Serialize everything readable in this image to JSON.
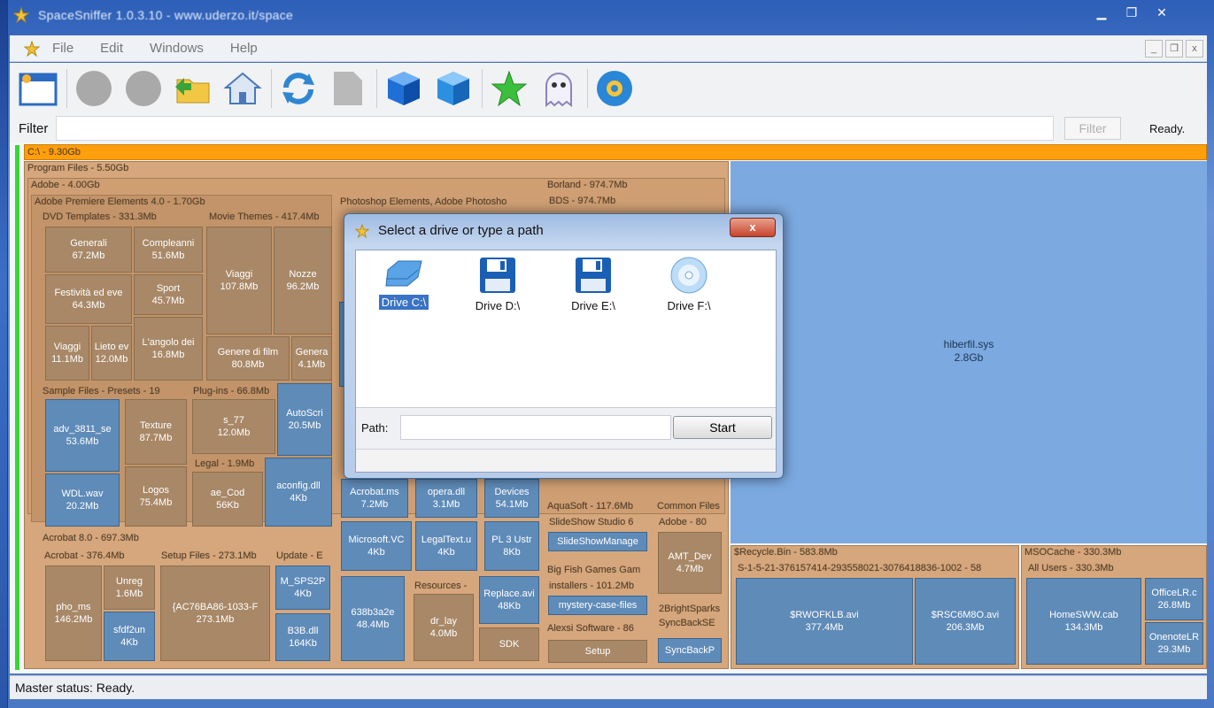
{
  "window": {
    "title": "SpaceSniffer 1.0.3.10 - www.uderzo.it/space"
  },
  "menu": [
    "File",
    "Edit",
    "Windows",
    "Help"
  ],
  "filter": {
    "label": "Filter",
    "value": "",
    "button": "Filter",
    "status": "Ready."
  },
  "treemap": {
    "root": "C:\\ - 9.30Gb",
    "labels": {
      "program_files": "Program Files - 5.50Gb",
      "adobe": "Adobe - 4.00Gb",
      "premiere": "Adobe Premiere Elements 4.0 - 1.70Gb",
      "photoshop": "Photoshop Elements, Adobe Photosho",
      "borland": "Borland - 974.7Mb",
      "bds": "BDS - 974.7Mb",
      "dvd": "DVD Templates - 331.3Mb",
      "movie": "Movie Themes - 417.4Mb",
      "sample": "Sample Files - Presets - 19",
      "plugins": "Plug-ins - 66.8Mb",
      "legal": "Legal - 1.9Mb",
      "acrobat": "Acrobat 8.0 - 697.3Mb",
      "acrobat2": "Acrobat - 376.4Mb",
      "setup_files": "Setup Files - 273.1Mb",
      "update": "Update - E",
      "resources": "Resources -",
      "aquasoft": "AquaSoft - 117.6Mb",
      "slideshow": "SlideShow Studio 6",
      "common": "Common Files",
      "adobe80": "Adobe - 80",
      "bigfish": "Big Fish Games Gam",
      "installers": "installers - 101.2Mb",
      "alexis": "Alexsi Software - 86",
      "brightspark": "2BrightSparks",
      "syncback": "SyncBackSE",
      "recycle": "$Recycle.Bin - 583.8Mb",
      "sid": "S-1-5-21-376157414-293558021-3076418836-1002 - 58",
      "msocache": "MSOCache - 330.3Mb",
      "allusers": "All Users - 330.3Mb"
    },
    "cells": {
      "generali": [
        "Generali",
        "67.2Mb"
      ],
      "compleanni": [
        "Compleanni",
        "51.6Mb"
      ],
      "viaggi": [
        "Viaggi",
        "107.8Mb"
      ],
      "nozze": [
        "Nozze",
        "96.2Mb"
      ],
      "festivita": [
        "Festività ed eve",
        "64.3Mb"
      ],
      "sport": [
        "Sport",
        "45.7Mb"
      ],
      "viaggi2": [
        "Viaggi",
        "11.1Mb"
      ],
      "lieto": [
        "Lieto ev",
        "12.0Mb"
      ],
      "angolo": [
        "L'angolo dei",
        "16.8Mb"
      ],
      "genere": [
        "Genere di film",
        "80.8Mb"
      ],
      "genera": [
        "Genera",
        "4.1Mb"
      ],
      "adv": [
        "adv_3811_se",
        "53.6Mb"
      ],
      "texture": [
        "Texture",
        "87.7Mb"
      ],
      "s77": [
        "s_77",
        "12.0Mb"
      ],
      "autoscri": [
        "AutoScri",
        "20.5Mb"
      ],
      "wav": [
        "WDL.wav",
        "20.2Mb"
      ],
      "logos": [
        "Logos",
        "75.4Mb"
      ],
      "ae_cod": [
        "ae_Cod",
        "56Kb"
      ],
      "aconfig": [
        "aconfig.dll",
        "4Kb"
      ],
      "acrobat_ms": [
        "Acrobat.ms",
        "7.2Mb"
      ],
      "opera": [
        "opera.dll",
        "3.1Mb"
      ],
      "devices": [
        "Devices",
        "54.1Mb"
      ],
      "msvc": [
        "Microsoft.VC",
        "4Kb"
      ],
      "legaltext": [
        "LegalText.u",
        "4Kb"
      ],
      "pl3": [
        "PL 3 Ustr",
        "8Kb"
      ],
      "pho": [
        "pho_ms",
        "146.2Mb"
      ],
      "unreg": [
        "Unreg",
        "1.6Mb"
      ],
      "ac": [
        "{AC76BA86-1033-F",
        "273.1Mb"
      ],
      "mspsp": [
        "M_SPS2P",
        "4Kb"
      ],
      "sfdf": [
        "sfdf2un",
        "4Kb"
      ],
      "b3b": [
        "B3B.dll",
        "164Kb"
      ],
      "b38": [
        "638b3a2e",
        "48.4Mb"
      ],
      "dr": [
        "dr_lay",
        "4.0Mb"
      ],
      "replace": [
        "Replace.avi",
        "48Kb"
      ],
      "sdk": [
        "SDK",
        ""
      ],
      "slideshow_m": [
        "SlideShowManage",
        ""
      ],
      "mystery": [
        "mystery-case-files",
        ""
      ],
      "amt": [
        "AMT_Dev",
        "4.7Mb"
      ],
      "setup": [
        "Setup",
        ""
      ],
      "syncback_f": [
        "SyncBackP",
        ""
      ],
      "hiberfil": [
        "hiberfil.sys",
        "2.8Gb"
      ],
      "rwo": [
        "$RWOFKLB.avi",
        "377.4Mb"
      ],
      "rs": [
        "$RSC6M8O.avi",
        "206.3Mb"
      ],
      "homeswi": [
        "HomeSWW.cab",
        "134.3Mb"
      ],
      "office": [
        "OfficeLR.c",
        "26.8Mb"
      ],
      "onenote": [
        "OnenoteLR",
        "29.3Mb"
      ]
    }
  },
  "status": {
    "text": "Master status: Ready."
  },
  "dialog": {
    "title": "Select a drive or type a path",
    "close": "x",
    "drives": [
      {
        "label": "Drive C:\\",
        "icon": "hard-drive-icon",
        "selected": true
      },
      {
        "label": "Drive D:\\",
        "icon": "floppy-icon",
        "selected": false
      },
      {
        "label": "Drive E:\\",
        "icon": "floppy-icon",
        "selected": false
      },
      {
        "label": "Drive F:\\",
        "icon": "optical-drive-icon",
        "selected": false
      }
    ],
    "path_label": "Path:",
    "path_value": "",
    "start": "Start"
  }
}
